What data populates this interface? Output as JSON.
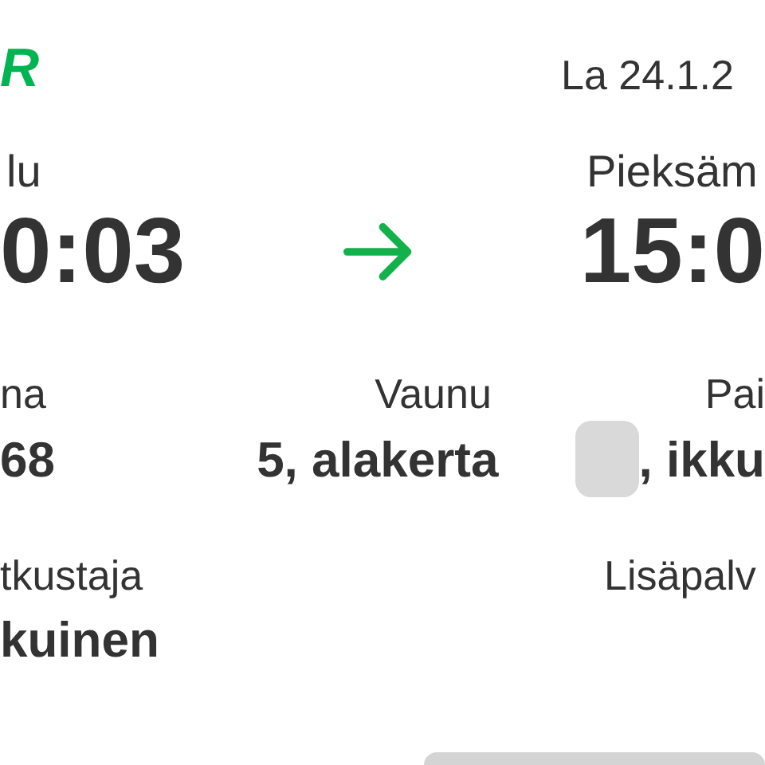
{
  "header": {
    "logo": "R",
    "date": "La 24.1.2"
  },
  "journey": {
    "from": {
      "station": "lu",
      "time": "0:03"
    },
    "to": {
      "station": "Pieksäm",
      "time": "15:0"
    }
  },
  "details": [
    {
      "label": "na",
      "value": "68"
    },
    {
      "label": "Vaunu",
      "value": "5, alakerta"
    },
    {
      "label": "Pai",
      "value": ", ikku",
      "redacted": true
    }
  ],
  "extras": [
    {
      "label": "tkustaja",
      "value": "kuinen"
    },
    {
      "label": "Lisäpalv"
    }
  ]
}
